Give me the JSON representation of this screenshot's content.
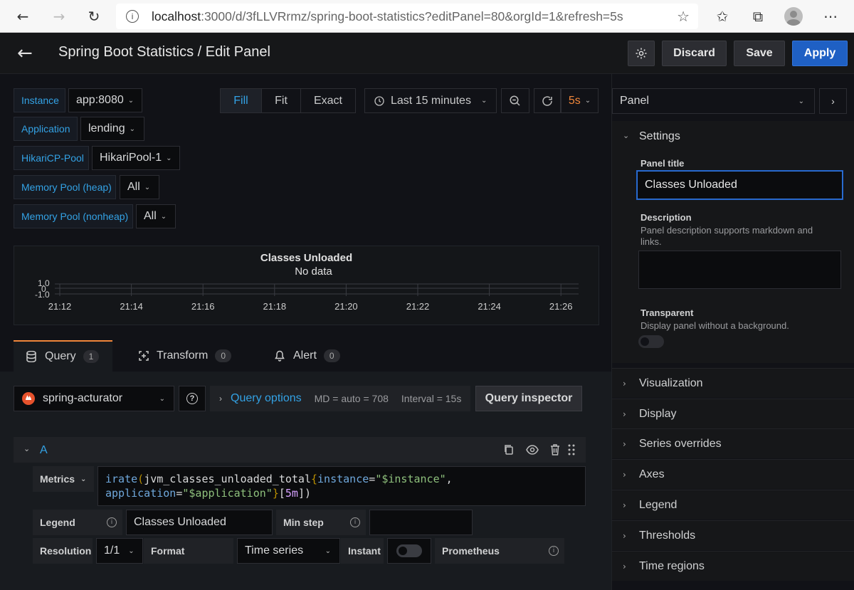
{
  "browser": {
    "url_host": "localhost",
    "url_rest": ":3000/d/3fLLVRrmz/spring-boot-statistics?editPanel=80&orgId=1&refresh=5s"
  },
  "header": {
    "title": "Spring Boot Statistics / Edit Panel",
    "discard": "Discard",
    "save": "Save",
    "apply": "Apply"
  },
  "variables": [
    {
      "label": "Instance",
      "value": "app:8080"
    },
    {
      "label": "Application",
      "value": "lending"
    },
    {
      "label": "HikariCP-Pool",
      "value": "HikariPool-1"
    },
    {
      "label": "Memory Pool (heap)",
      "value": "All"
    },
    {
      "label": "Memory Pool (nonheap)",
      "value": "All"
    }
  ],
  "view_modes": [
    "Fill",
    "Fit",
    "Exact"
  ],
  "time_range": "Last 15 minutes",
  "refresh": "5s",
  "panel_preview": {
    "title": "Classes Unloaded",
    "no_data": "No data",
    "y_ticks": [
      "1.0",
      "0",
      "-1.0"
    ],
    "x_ticks": [
      "21:12",
      "21:14",
      "21:16",
      "21:18",
      "21:20",
      "21:22",
      "21:24",
      "21:26"
    ]
  },
  "tabs": [
    {
      "label": "Query",
      "count": "1"
    },
    {
      "label": "Transform",
      "count": "0"
    },
    {
      "label": "Alert",
      "count": "0"
    }
  ],
  "query": {
    "datasource": "spring-acturator",
    "options_label": "Query options",
    "md": "MD = auto = 708",
    "interval": "Interval = 15s",
    "inspector": "Query inspector",
    "ref": "A",
    "metrics_label": "Metrics",
    "expr": {
      "fn": "irate",
      "metric": "jvm_classes_unloaded_total",
      "k1": "instance",
      "v1": "\"$instance\"",
      "k2": "application",
      "v2": "\"$application\"",
      "range": "5m"
    },
    "legend_label": "Legend",
    "legend_value": "Classes Unloaded",
    "min_step_label": "Min step",
    "resolution_label": "Resolution",
    "resolution_value": "1/1",
    "format_label": "Format",
    "format_value": "Time series",
    "instant_label": "Instant",
    "prometheus_label": "Prometheus"
  },
  "side": {
    "selector": "Panel",
    "settings": "Settings",
    "panel_title_label": "Panel title",
    "panel_title_value": "Classes Unloaded",
    "description_label": "Description",
    "description_hint": "Panel description supports markdown and links.",
    "transparent_label": "Transparent",
    "transparent_hint": "Display panel without a background.",
    "sections": [
      "Visualization",
      "Display",
      "Series overrides",
      "Axes",
      "Legend",
      "Thresholds",
      "Time regions"
    ]
  }
}
